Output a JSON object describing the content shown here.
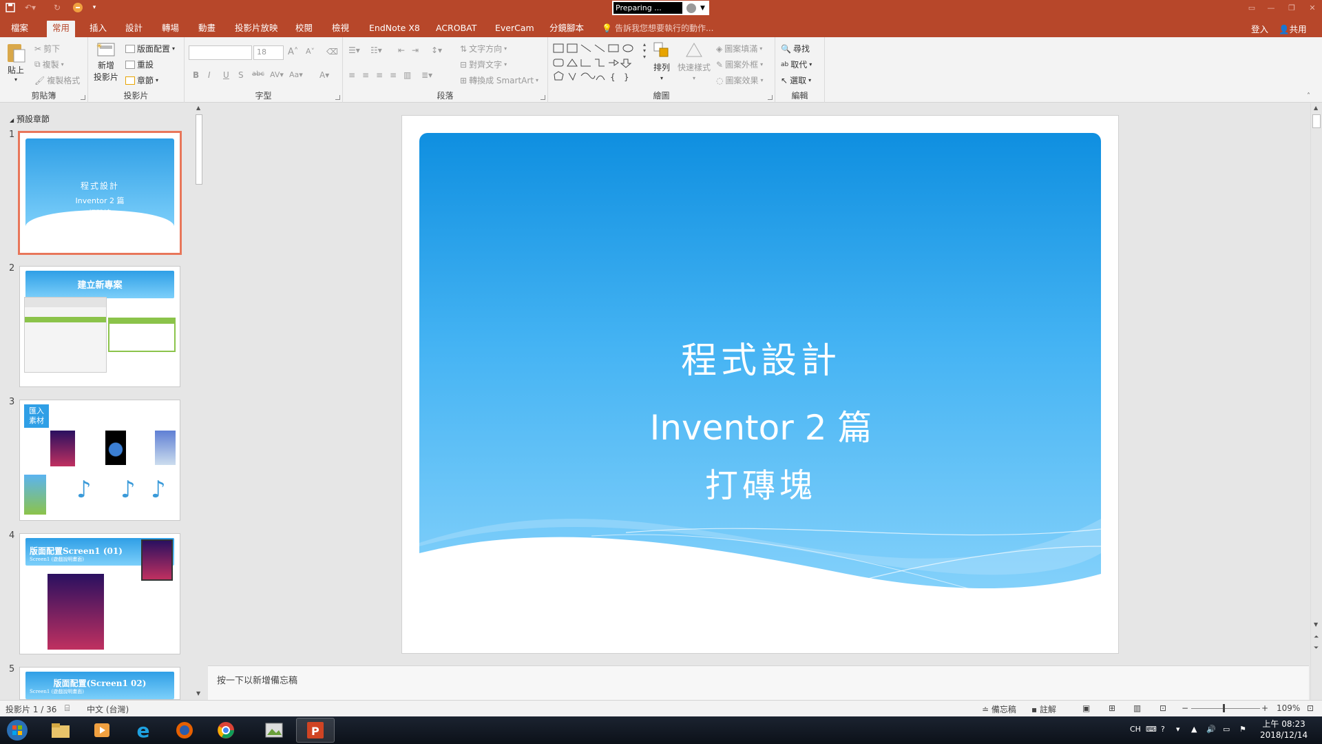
{
  "titlebar": {
    "preparing": "Preparing ..."
  },
  "tabs": [
    {
      "label": "檔案"
    },
    {
      "label": "常用"
    },
    {
      "label": "插入"
    },
    {
      "label": "設計"
    },
    {
      "label": "轉場"
    },
    {
      "label": "動畫"
    },
    {
      "label": "投影片放映"
    },
    {
      "label": "校閱"
    },
    {
      "label": "檢視"
    },
    {
      "label": "EndNote X8"
    },
    {
      "label": "ACROBAT"
    },
    {
      "label": "EverCam"
    },
    {
      "label": "分鏡腳本"
    }
  ],
  "tellme": "告訴我您想要執行的動作...",
  "account": {
    "signin": "登入",
    "share": "共用"
  },
  "ribbon": {
    "clipboard": {
      "label": "剪貼簿",
      "paste": "貼上",
      "cut": "剪下",
      "copy": "複製",
      "format_painter": "複製格式"
    },
    "slides": {
      "label": "投影片",
      "new_slide": "新增",
      "new_slide2": "投影片",
      "layout": "版面配置",
      "reset": "重設",
      "section": "章節"
    },
    "font": {
      "label": "字型",
      "size": "18"
    },
    "paragraph": {
      "label": "段落",
      "text_direction": "文字方向",
      "align_text": "對齊文字",
      "smartart": "轉換成 SmartArt"
    },
    "drawing": {
      "label": "繪圖",
      "arrange": "排列",
      "quick_styles": "快速樣式",
      "shape_fill": "圖案填滿",
      "shape_outline": "圖案外框",
      "shape_effects": "圖案效果"
    },
    "editing": {
      "label": "編輯",
      "find": "尋找",
      "replace": "取代",
      "select": "選取"
    }
  },
  "sidebar": {
    "section": "預設章節",
    "slides": [
      {
        "num": "1",
        "t1": "程式設計",
        "t2": "Inventor 2 篇",
        "t3": "打磚塊"
      },
      {
        "num": "2",
        "t1": "建立新專案"
      },
      {
        "num": "3",
        "t1": "匯入",
        "t2": "素材"
      },
      {
        "num": "4",
        "t1": "版面配置Screen1 (01)",
        "t2": "Screen1 (遊戲說明畫面)"
      },
      {
        "num": "5",
        "t1": "版面配置(Screen1 02)",
        "t2": "Screen1 (遊戲說明畫面)"
      }
    ]
  },
  "slide": {
    "title": "程式設計",
    "subtitle1": "Inventor 2 篇",
    "subtitle2": "打磚塊"
  },
  "notes_placeholder": "按一下以新增備忘稿",
  "statusbar": {
    "slide_info": "投影片 1 / 36",
    "language": "中文 (台灣)",
    "notes": "備忘稿",
    "comments": "註解",
    "zoom": "109%"
  },
  "taskbar": {
    "ime": "CH",
    "time": "上午 08:23",
    "date": "2018/12/14"
  },
  "colors": {
    "accent": "#b7472a",
    "slide_blue_top": "#0f8fe0",
    "slide_blue_bottom": "#86d2fb"
  }
}
